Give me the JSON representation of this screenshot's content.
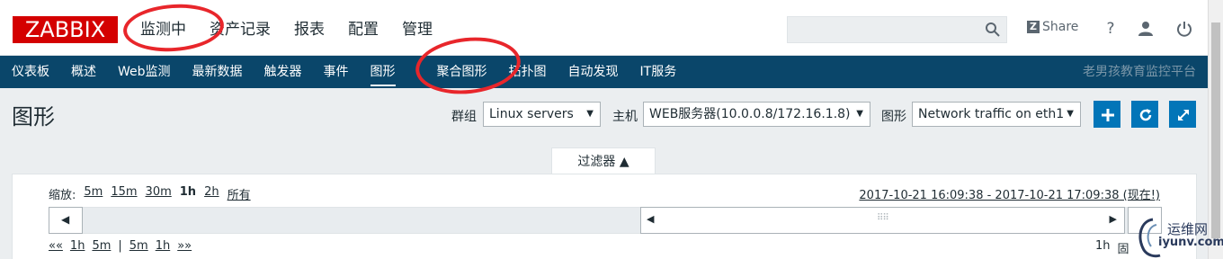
{
  "header": {
    "logo": "ZABBIX",
    "menu": [
      "监测中",
      "资产记录",
      "报表",
      "配置",
      "管理"
    ],
    "share_label": "Share",
    "help_label": "?"
  },
  "subnav": {
    "items": [
      "仪表板",
      "概述",
      "Web监测",
      "最新数据",
      "触发器",
      "事件",
      "图形",
      "聚合图形",
      "拓扑图",
      "自动发现",
      "IT服务"
    ],
    "active": "图形",
    "brand": "老男孩教育监控平台"
  },
  "page": {
    "title": "图形",
    "filters": {
      "group_label": "群组",
      "group_value": "Linux servers",
      "host_label": "主机",
      "host_value": "WEB服务器(10.0.0.8/172.16.1.8)",
      "graph_label": "图形",
      "graph_value": "Network traffic on eth1"
    }
  },
  "filter": {
    "tab_label": "过滤器 ▲",
    "zoom_label": "缩放:",
    "zoom_options": [
      "5m",
      "15m",
      "30m",
      "1h",
      "2h",
      "所有"
    ],
    "zoom_selected": "1h",
    "time_range": "2017-10-21 16:09:38 - 2017-10-21 17:09:38 (现在!)",
    "nav_left": [
      "««",
      "1h",
      "5m",
      "|",
      "5m",
      "1h",
      "»»"
    ],
    "nav_right": [
      "1h",
      "固"
    ]
  },
  "watermark": {
    "line1": "运维网",
    "line2": "iyunv.com"
  },
  "colors": {
    "logo_bg": "#d40000",
    "subnav_bg": "#0a466a",
    "button_blue": "#0275b8",
    "annotation_red": "#e8262b"
  }
}
